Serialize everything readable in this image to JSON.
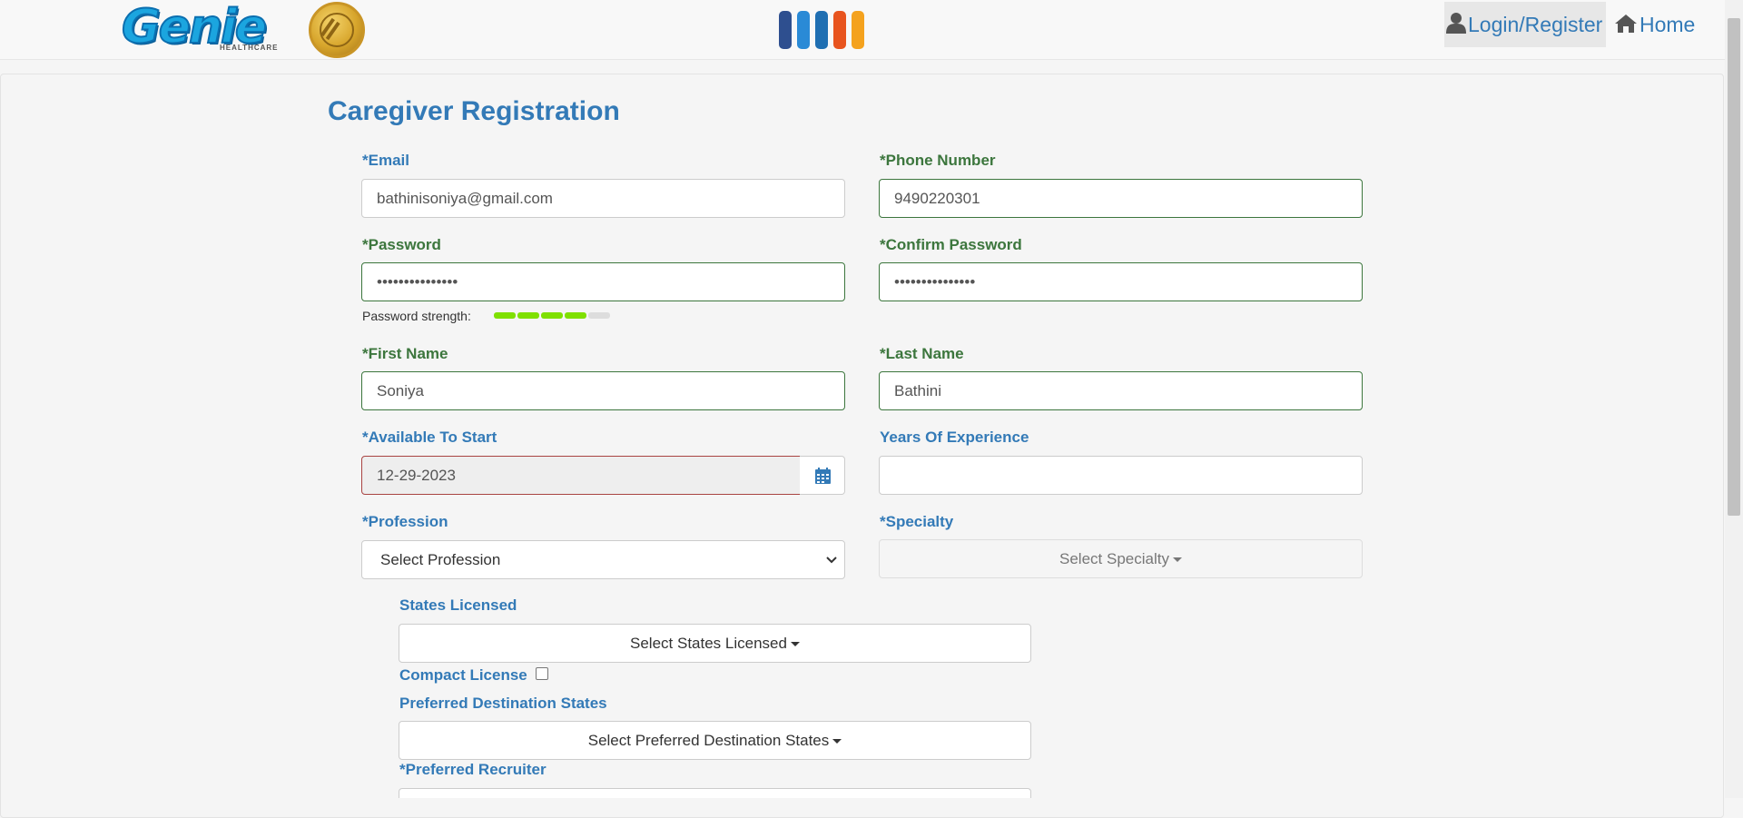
{
  "header": {
    "logo_text": "Genie",
    "logo_subtext": "HEALTHCARE",
    "bar_colors": [
      "#2e4f8f",
      "#2a8ad6",
      "#1f6fb2",
      "#e8541e",
      "#f4a21e"
    ],
    "login_label": "Login/Register",
    "home_label": "Home"
  },
  "page": {
    "title": "Caregiver Registration"
  },
  "form": {
    "email": {
      "label": "*Email",
      "value": "bathinisoniya@gmail.com"
    },
    "phone": {
      "label": "*Phone Number",
      "value": "9490220301"
    },
    "password": {
      "label": "*Password",
      "value": "•••••••••••••••"
    },
    "confirm_password": {
      "label": "*Confirm Password",
      "value": "•••••••••••••••"
    },
    "password_strength": {
      "label": "Password strength:",
      "filled_segments": 4,
      "total_segments": 5
    },
    "first_name": {
      "label": "*First Name",
      "value": "Soniya"
    },
    "last_name": {
      "label": "*Last Name",
      "value": "Bathini"
    },
    "available_to_start": {
      "label": "*Available To Start",
      "value": "12-29-2023"
    },
    "years_of_experience": {
      "label": "Years Of Experience",
      "value": ""
    },
    "profession": {
      "label": "*Profession",
      "selected": "Select Profession"
    },
    "specialty": {
      "label": "*Specialty",
      "button": "Select Specialty"
    },
    "states_licensed": {
      "label": "States Licensed",
      "button": "Select States Licensed"
    },
    "compact_license": {
      "label": "Compact License",
      "checked": false
    },
    "preferred_destination_states": {
      "label": "Preferred Destination States",
      "button": "Select Preferred Destination States"
    },
    "preferred_recruiter": {
      "label": "*Preferred Recruiter"
    }
  },
  "colors": {
    "primary": "#337ab7",
    "success": "#3c763d",
    "error": "#a94442",
    "strength_filled": "#7fe000",
    "strength_empty": "#dddddd"
  }
}
